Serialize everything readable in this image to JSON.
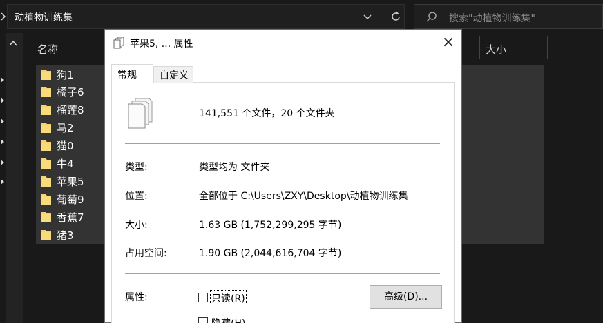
{
  "explorer": {
    "address": "动植物训练集",
    "search_placeholder": "搜索\"动植物训练集\"",
    "columns": {
      "name": "名称",
      "size": "大小"
    },
    "items": [
      {
        "name": "狗1"
      },
      {
        "name": "橘子6"
      },
      {
        "name": "榴莲8"
      },
      {
        "name": "马2"
      },
      {
        "name": "猫0"
      },
      {
        "name": "牛4"
      },
      {
        "name": "苹果5"
      },
      {
        "name": "葡萄9"
      },
      {
        "name": "香蕉7"
      },
      {
        "name": "猪3"
      }
    ]
  },
  "dialog": {
    "title": "苹果5, ... 属性",
    "close": "×",
    "tabs": {
      "general": "常规",
      "custom": "自定义"
    },
    "summary": "141,551 个文件，20 个文件夹",
    "type_label": "类型:",
    "type_value": "类型均为 文件夹",
    "location_label": "位置:",
    "location_value": "全部位于 C:\\Users\\ZXY\\Desktop\\动植物训练集",
    "size_label": "大小:",
    "size_value": "1.63 GB (1,752,299,295 字节)",
    "disk_label": "占用空间:",
    "disk_value": "1.90 GB (2,044,616,704 字节)",
    "attr_label": "属性:",
    "readonly": "只读(R)",
    "hidden": "隐藏(H)",
    "advanced": "高级(D)..."
  },
  "icons": {
    "folder": "folder-icon",
    "files": "multiple-files-icon",
    "refresh": "refresh-icon",
    "search": "search-icon"
  },
  "colors": {
    "explorer_bg": "#191919",
    "selection": "#333333",
    "folder": "#f6d36c",
    "dialog_bg": "#ffffff"
  }
}
